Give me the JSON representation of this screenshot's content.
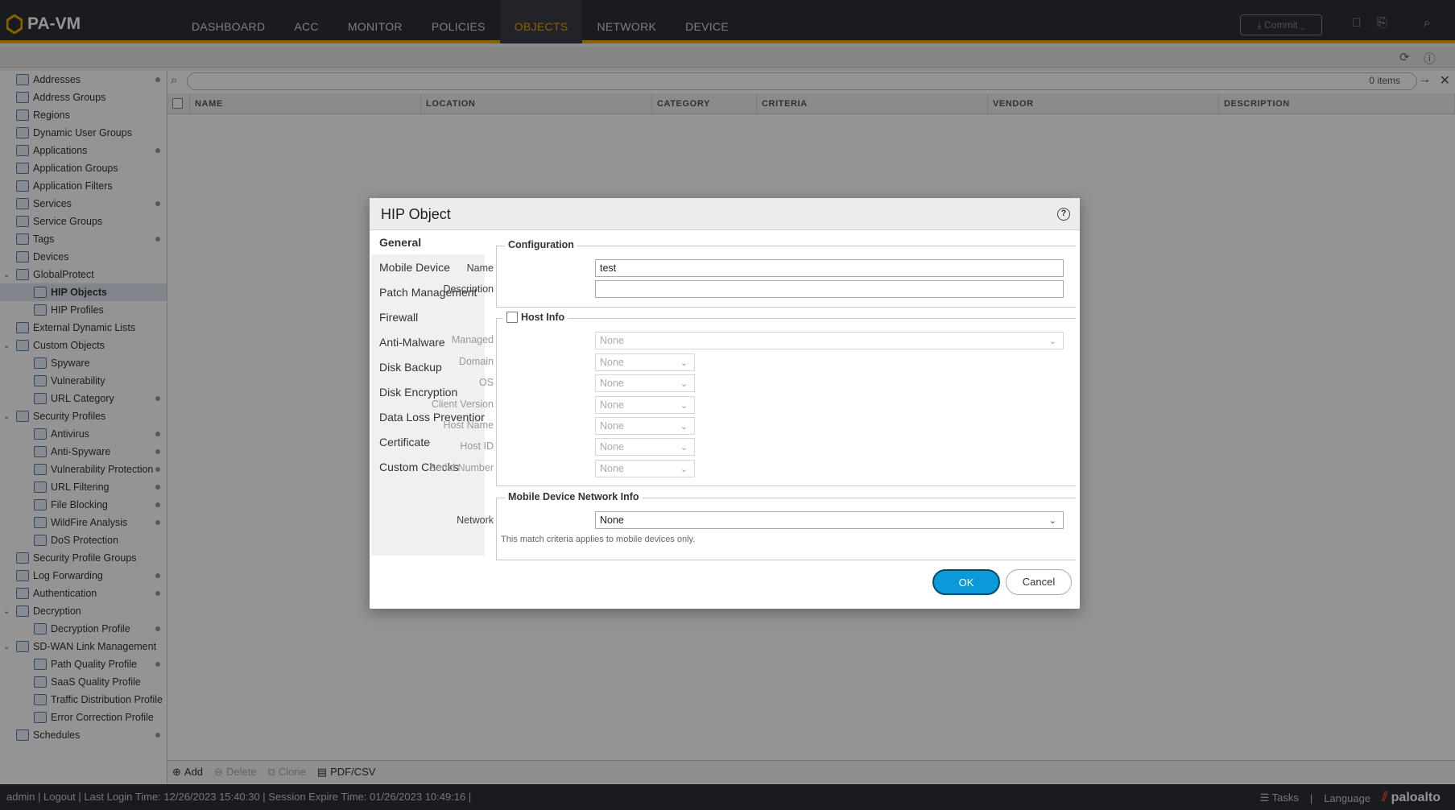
{
  "app": {
    "logo": "PA-VM",
    "nav_tabs": [
      "DASHBOARD",
      "ACC",
      "MONITOR",
      "POLICIES",
      "OBJECTS",
      "NETWORK",
      "DEVICE"
    ],
    "active_tab": "OBJECTS",
    "commit_label": "Commit",
    "accent_color": "#f0a500"
  },
  "sidebar": {
    "items": [
      {
        "label": "Addresses",
        "level": 0,
        "dot": true
      },
      {
        "label": "Address Groups",
        "level": 0,
        "dot": false
      },
      {
        "label": "Regions",
        "level": 0,
        "dot": false
      },
      {
        "label": "Dynamic User Groups",
        "level": 0,
        "dot": false
      },
      {
        "label": "Applications",
        "level": 0,
        "dot": true
      },
      {
        "label": "Application Groups",
        "level": 0,
        "dot": false
      },
      {
        "label": "Application Filters",
        "level": 0,
        "dot": false
      },
      {
        "label": "Services",
        "level": 0,
        "dot": true
      },
      {
        "label": "Service Groups",
        "level": 0,
        "dot": false
      },
      {
        "label": "Tags",
        "level": 0,
        "dot": true
      },
      {
        "label": "Devices",
        "level": 0,
        "dot": false
      },
      {
        "label": "GlobalProtect",
        "level": 0,
        "dot": false,
        "expanded": true
      },
      {
        "label": "HIP Objects",
        "level": 1,
        "dot": false,
        "selected": true
      },
      {
        "label": "HIP Profiles",
        "level": 1,
        "dot": false
      },
      {
        "label": "External Dynamic Lists",
        "level": 0,
        "dot": false
      },
      {
        "label": "Custom Objects",
        "level": 0,
        "dot": false,
        "expanded": true
      },
      {
        "label": "Spyware",
        "level": 1,
        "dot": false
      },
      {
        "label": "Vulnerability",
        "level": 1,
        "dot": false
      },
      {
        "label": "URL Category",
        "level": 1,
        "dot": true
      },
      {
        "label": "Security Profiles",
        "level": 0,
        "dot": false,
        "expanded": true
      },
      {
        "label": "Antivirus",
        "level": 1,
        "dot": true
      },
      {
        "label": "Anti-Spyware",
        "level": 1,
        "dot": true
      },
      {
        "label": "Vulnerability Protection",
        "level": 1,
        "dot": true
      },
      {
        "label": "URL Filtering",
        "level": 1,
        "dot": true
      },
      {
        "label": "File Blocking",
        "level": 1,
        "dot": true
      },
      {
        "label": "WildFire Analysis",
        "level": 1,
        "dot": true
      },
      {
        "label": "DoS Protection",
        "level": 1,
        "dot": false
      },
      {
        "label": "Security Profile Groups",
        "level": 0,
        "dot": false
      },
      {
        "label": "Log Forwarding",
        "level": 0,
        "dot": true
      },
      {
        "label": "Authentication",
        "level": 0,
        "dot": true
      },
      {
        "label": "Decryption",
        "level": 0,
        "dot": false,
        "expanded": true
      },
      {
        "label": "Decryption Profile",
        "level": 1,
        "dot": true
      },
      {
        "label": "SD-WAN Link Management",
        "level": 0,
        "dot": false,
        "expanded": true
      },
      {
        "label": "Path Quality Profile",
        "level": 1,
        "dot": true
      },
      {
        "label": "SaaS Quality Profile",
        "level": 1,
        "dot": false
      },
      {
        "label": "Traffic Distribution Profile",
        "level": 1,
        "dot": false
      },
      {
        "label": "Error Correction Profile",
        "level": 1,
        "dot": false
      },
      {
        "label": "Schedules",
        "level": 0,
        "dot": true
      }
    ]
  },
  "grid": {
    "items_count": "0 items",
    "columns": [
      "NAME",
      "LOCATION",
      "CATEGORY",
      "CRITERIA",
      "VENDOR",
      "DESCRIPTION"
    ],
    "footer": {
      "add": "Add",
      "delete": "Delete",
      "clone": "Clone",
      "pdf": "PDF/CSV"
    }
  },
  "status": {
    "user": "admin",
    "logout": "Logout",
    "last_login": "Last Login Time: 12/26/2023 15:40:30",
    "session": "Session Expire Time: 01/26/2023 10:49:16",
    "tasks": "Tasks",
    "language": "Language",
    "brand": "paloalto"
  },
  "dialog": {
    "title": "HIP Object",
    "tabs": [
      "General",
      "Mobile Device",
      "Patch Management",
      "Firewall",
      "Anti-Malware",
      "Disk Backup",
      "Disk Encryption",
      "Data Loss Prevention",
      "Certificate",
      "Custom Checks"
    ],
    "configuration": {
      "legend": "Configuration",
      "name_label": "Name",
      "name_value": "test",
      "description_label": "Description",
      "description_value": ""
    },
    "host_info": {
      "legend": "Host Info",
      "checked": false,
      "fields": [
        {
          "label": "Managed",
          "value": "None"
        },
        {
          "label": "Domain",
          "value": "None"
        },
        {
          "label": "OS",
          "value": "None"
        },
        {
          "label": "Client Version",
          "value": "None"
        },
        {
          "label": "Host Name",
          "value": "None"
        },
        {
          "label": "Host ID",
          "value": "None"
        },
        {
          "label": "Serial Number",
          "value": "None"
        }
      ]
    },
    "mobile_network": {
      "legend": "Mobile Device Network Info",
      "network_label": "Network",
      "network_value": "None",
      "note": "This match criteria applies to mobile devices only."
    },
    "ok_label": "OK",
    "cancel_label": "Cancel",
    "ok_color": "#0a9ad9"
  }
}
